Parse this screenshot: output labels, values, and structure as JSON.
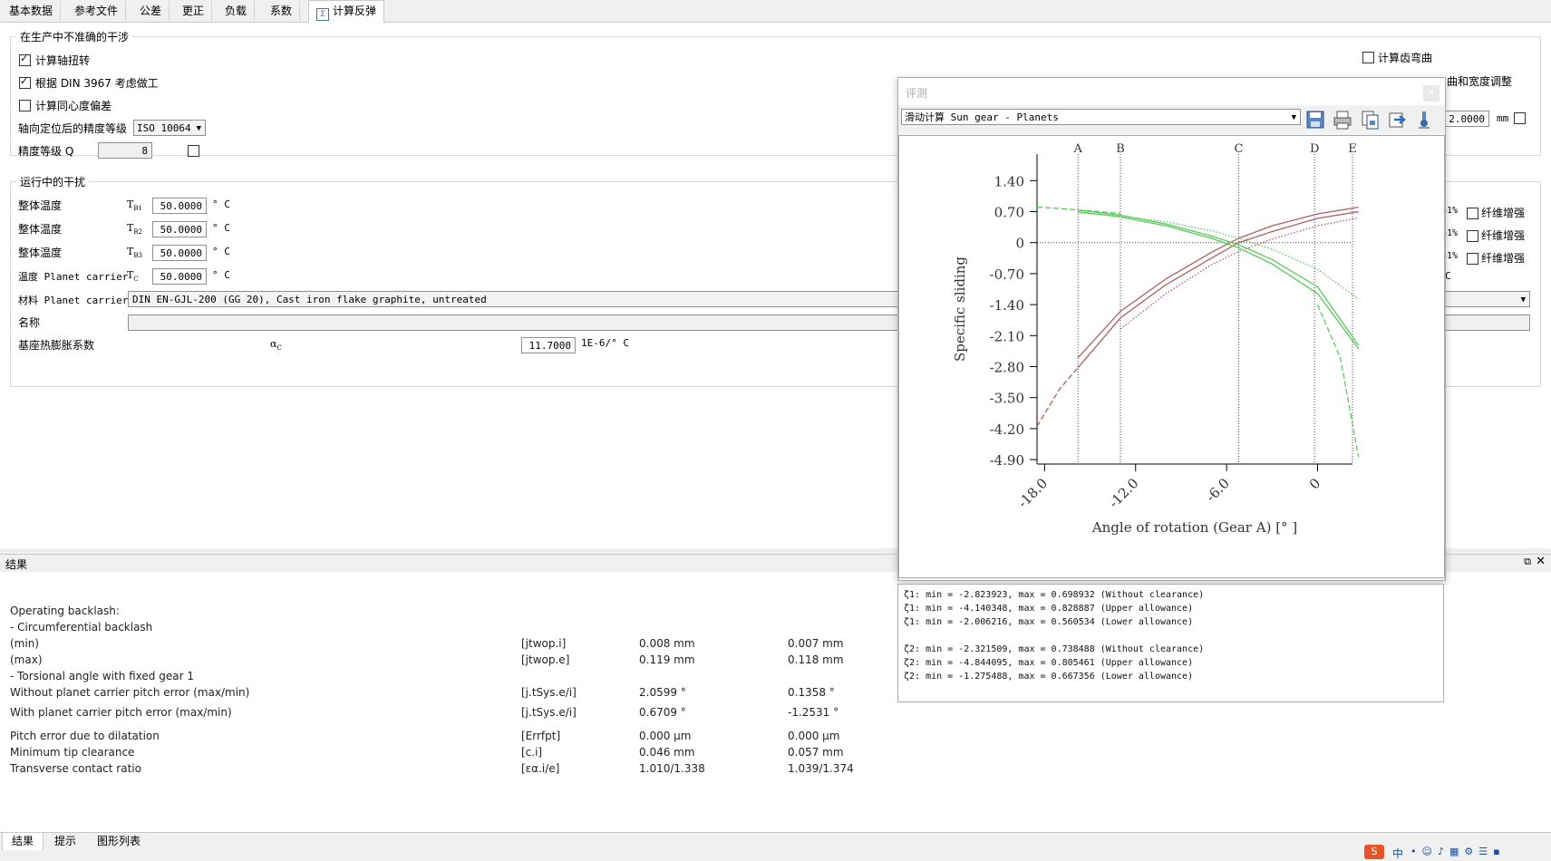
{
  "tabs": [
    "基本数据",
    "参考文件",
    "公差",
    "更正",
    "负载",
    "系数",
    "计算反弹"
  ],
  "active_tab": "计算反弹",
  "group1": {
    "legend": "在生产中不准确的干涉",
    "cb_torsion": "计算轴扭转",
    "cb_din": "根据 DIN 3967 考虑做工",
    "cb_concentric": "计算同心度偏差",
    "axial_label": "轴向定位后的精度等级",
    "axial_value": "ISO 10064",
    "quality_label": "精度等级 Q",
    "quality_value": "8",
    "cb_tooth_bending": "计算齿弯曲",
    "width_adjust_label": "曲和宽度调整",
    "right_value": "2.0000",
    "right_unit": "mm"
  },
  "group2": {
    "legend": "运行中的干扰",
    "rows": [
      {
        "label": "整体温度",
        "sym": "T",
        "sub": "B1",
        "value": "50.0000",
        "unit": "° C"
      },
      {
        "label": "整体温度",
        "sym": "T",
        "sub": "B2",
        "value": "50.0000",
        "unit": "° C"
      },
      {
        "label": "整体温度",
        "sym": "T",
        "sub": "B3",
        "value": "50.0000",
        "unit": "° C"
      },
      {
        "label": "温度 Planet carrier",
        "sym": "T",
        "sub": "C",
        "value": "50.0000",
        "unit": "° C"
      }
    ],
    "material_label": "材料 Planet carrier",
    "material_value": "DIN EN-GJL-200 (GG 20), Cast iron flake graphite, untreated",
    "name_label": "名称",
    "coef_label": "基座热膨胀系数",
    "coef_sym": "α",
    "coef_sub": "C",
    "coef_value": "11.7000",
    "coef_unit": "1E-6/° C",
    "right_fragments": [
      "61%",
      "61%",
      "61%"
    ],
    "right_checkbox_labels": [
      "纤维增强",
      "纤维增强",
      "纤维增强"
    ],
    "right_c": "C"
  },
  "results": {
    "title": "结果",
    "rows": [
      {
        "label": "Operating backlash:",
        "sym": "",
        "v1": "",
        "v2": ""
      },
      {
        "label": "- Circumferential backlash",
        "sym": "",
        "v1": "",
        "v2": ""
      },
      {
        "label": "(min)",
        "sym": "[jtwop.i]",
        "v1": "0.008 mm",
        "v2": "0.007 mm"
      },
      {
        "label": "(max)",
        "sym": "[jtwop.e]",
        "v1": "0.119 mm",
        "v2": "0.118 mm"
      },
      {
        "label": "- Torsional angle with fixed gear 1",
        "sym": "",
        "v1": "",
        "v2": ""
      },
      {
        "label": "Without planet carrier pitch error (max/min)",
        "sym": "[j.tSys.e/i]",
        "v1": "2.0599 °",
        "v2": "0.1358 °"
      },
      {
        "label": "With planet carrier pitch error (max/min)",
        "sym": "[j.tSys.e/i]",
        "v1": "0.6709 °",
        "v2": "-1.2531 °"
      },
      {
        "label": "Pitch error due to dilatation",
        "sym": "[Errfpt]",
        "v1": "0.000 µm",
        "v2": "0.000 µm"
      },
      {
        "label": "Minimum tip clearance",
        "sym": "[c.i]",
        "v1": "0.046 mm",
        "v2": "0.057 mm"
      },
      {
        "label": "Transverse contact ratio",
        "sym": "[εα.i/e]",
        "v1": "1.010/1.338",
        "v2": "1.039/1.374"
      }
    ]
  },
  "bottom_tabs": [
    "结果",
    "提示",
    "图形列表"
  ],
  "float_window": {
    "title": "评测",
    "dropdown": "滑动计算 Sun gear - Planets",
    "toolbar_icons": [
      "save-icon",
      "print-icon",
      "copy-icon",
      "export-icon",
      "settings-icon"
    ]
  },
  "chart_data": {
    "type": "line",
    "xlabel": "Angle of rotation (Gear A) [° ]",
    "ylabel": "Specific sliding",
    "xticks": [
      "-18.0",
      "-12.0",
      "-6.0",
      "0"
    ],
    "xtick_values": [
      -18,
      -12,
      -6,
      0
    ],
    "yticks": [
      "1.40",
      "0.70",
      "0",
      "-0.70",
      "-1.40",
      "-2.10",
      "-2.80",
      "-3.50",
      "-4.20",
      "-4.90"
    ],
    "ytick_values": [
      1.4,
      0.7,
      0,
      -0.7,
      -1.4,
      -2.1,
      -2.8,
      -3.5,
      -4.2,
      -4.9
    ],
    "xlim": [
      -18.5,
      2.3
    ],
    "ylim": [
      -5.0,
      2.0
    ],
    "markers": [
      {
        "label": "A",
        "x": -15.8
      },
      {
        "label": "B",
        "x": -13.0
      },
      {
        "label": "C",
        "x": -5.2
      },
      {
        "label": "D",
        "x": -0.2
      },
      {
        "label": "E",
        "x": 2.7
      }
    ],
    "series": [
      {
        "color": "#b06060",
        "style": "solid",
        "x": [
          -15.8,
          -13.0,
          -10.0,
          -7.0,
          -5.2,
          -3.0,
          0.0,
          2.7
        ],
        "y": [
          -2.823923,
          -1.7,
          -0.95,
          -0.35,
          0.0,
          0.25,
          0.55,
          0.698932
        ]
      },
      {
        "color": "#b06060",
        "style": "solid",
        "x": [
          -15.8,
          -13.0,
          -10.0,
          -7.0,
          -5.2,
          -3.0,
          0.0,
          2.7
        ],
        "y": [
          -2.6,
          -1.55,
          -0.82,
          -0.22,
          0.1,
          0.38,
          0.65,
          0.8
        ]
      },
      {
        "color": "#b06060",
        "style": "dash",
        "x": [
          -18.5,
          -17.0,
          -15.8
        ],
        "y": [
          -4.15,
          -3.3,
          -2.823923
        ]
      },
      {
        "color": "#b06060",
        "style": "dot",
        "x": [
          -13.0,
          -10.0,
          -7.0,
          -5.2,
          -3.0,
          0.0,
          2.7
        ],
        "y": [
          -1.95,
          -1.15,
          -0.5,
          -0.2,
          0.08,
          0.38,
          0.560534
        ]
      },
      {
        "color": "#5bc85b",
        "style": "solid",
        "x": [
          -15.8,
          -13.0,
          -10.0,
          -7.0,
          -5.2,
          -3.0,
          0.0,
          2.7
        ],
        "y": [
          0.738488,
          0.62,
          0.42,
          0.15,
          -0.05,
          -0.38,
          -1.0,
          -2.321509
        ]
      },
      {
        "color": "#5bc85b",
        "style": "solid",
        "x": [
          -15.8,
          -13.0,
          -10.0,
          -7.0,
          -5.2,
          -3.0,
          0.0,
          2.7
        ],
        "y": [
          0.7,
          0.58,
          0.38,
          0.1,
          -0.12,
          -0.48,
          -1.15,
          -2.4
        ]
      },
      {
        "color": "#5bc85b",
        "style": "dash",
        "x": [
          -18.5,
          -15.8,
          -13.0
        ],
        "y": [
          0.805461,
          0.74,
          0.66
        ]
      },
      {
        "color": "#5bc85b",
        "style": "dash",
        "x": [
          0.0,
          1.5,
          2.7
        ],
        "y": [
          -1.4,
          -2.6,
          -4.844095
        ]
      },
      {
        "color": "#5bc85b",
        "style": "dot",
        "x": [
          -15.8,
          -13.0,
          -10.0,
          -7.0,
          -5.2,
          -3.0,
          0.0,
          2.7
        ],
        "y": [
          0.667356,
          0.6,
          0.47,
          0.27,
          0.1,
          -0.15,
          -0.6,
          -1.275488
        ]
      }
    ]
  },
  "summary_lines": [
    "ζ1: min = -2.823923, max = 0.698932 (Without clearance)",
    "ζ1: min = -4.140348, max = 0.828887 (Upper allowance)",
    "ζ1: min = -2.006216, max = 0.560534 (Lower allowance)",
    "",
    "ζ2: min = -2.321509, max = 0.738488 (Without clearance)",
    "ζ2: min = -4.844095, max = 0.805461 (Upper allowance)",
    "ζ2: min = -1.275488, max = 0.667356 (Lower allowance)"
  ],
  "taskbar": {
    "ime": "中"
  }
}
